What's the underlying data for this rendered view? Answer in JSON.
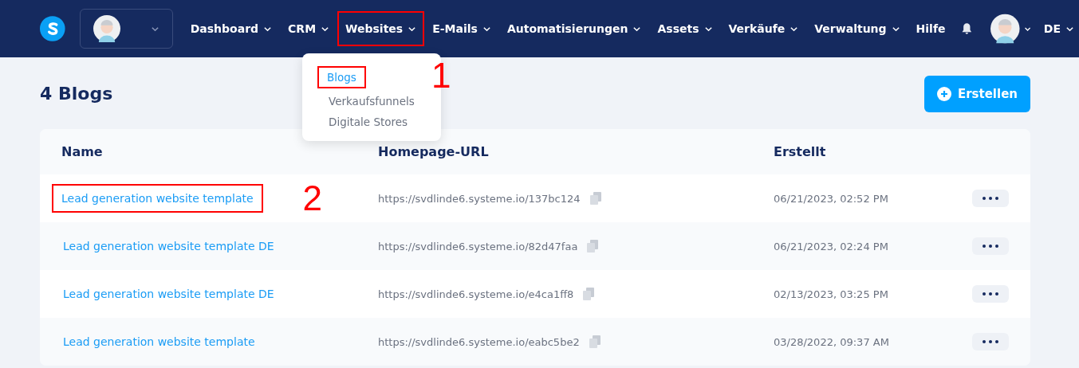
{
  "nav": {
    "items": [
      {
        "label": "Dashboard",
        "caret": true,
        "highlighted": false
      },
      {
        "label": "CRM",
        "caret": true,
        "highlighted": false
      },
      {
        "label": "Websites",
        "caret": true,
        "highlighted": true
      },
      {
        "label": "E-Mails",
        "caret": true,
        "highlighted": false
      },
      {
        "label": "Automatisierungen",
        "caret": true,
        "highlighted": false
      },
      {
        "label": "Assets",
        "caret": true,
        "highlighted": false
      },
      {
        "label": "Verkäufe",
        "caret": true,
        "highlighted": false
      },
      {
        "label": "Verwaltung",
        "caret": true,
        "highlighted": false
      },
      {
        "label": "Hilfe",
        "caret": false,
        "highlighted": false
      }
    ],
    "language": "DE"
  },
  "dropdown": {
    "items": [
      {
        "label": "Blogs",
        "selected": true,
        "highlighted": true
      },
      {
        "label": "Verkaufsfunnels",
        "selected": false,
        "highlighted": false
      },
      {
        "label": "Digitale Stores",
        "selected": false,
        "highlighted": false
      }
    ],
    "annotation": "1"
  },
  "page": {
    "title": "4 Blogs",
    "create_button": "Erstellen"
  },
  "table": {
    "columns": [
      "Name",
      "Homepage-URL",
      "Erstellt"
    ],
    "rows": [
      {
        "name": "Lead generation website template",
        "url": "https://svdlinde6.systeme.io/137bc124",
        "created": "06/21/2023, 02:52 PM",
        "highlighted": true
      },
      {
        "name": "Lead generation website template DE",
        "url": "https://svdlinde6.systeme.io/82d47faa",
        "created": "06/21/2023, 02:24 PM",
        "highlighted": false
      },
      {
        "name": "Lead generation website template DE",
        "url": "https://svdlinde6.systeme.io/e4ca1ff8",
        "created": "02/13/2023, 03:25 PM",
        "highlighted": false
      },
      {
        "name": "Lead generation website template",
        "url": "https://svdlinde6.systeme.io/eabc5be2",
        "created": "03/28/2022, 09:37 AM",
        "highlighted": false
      }
    ],
    "annotation": "2"
  }
}
